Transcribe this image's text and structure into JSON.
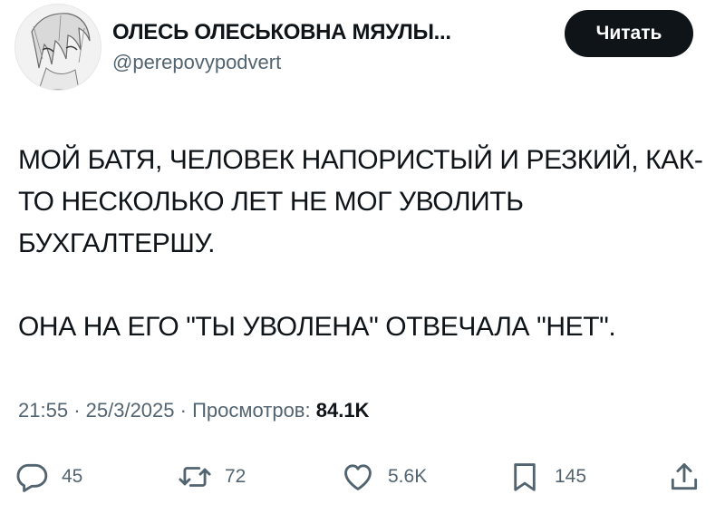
{
  "author": {
    "display_name": "ОЛЕСЬ ОЛЕСЬКОВНА МЯУЛЫ...",
    "handle": "@perepovypodvert",
    "follow_label": "Читать"
  },
  "tweet": {
    "paragraphs": [
      "МОЙ БАТЯ, ЧЕЛОВЕК НАПОРИСТЫЙ И РЕЗКИЙ, КАК-ТО НЕСКОЛЬКО ЛЕТ НЕ МОГ УВОЛИТЬ БУХГАЛТЕРШУ.",
      "ОНА НА ЕГО \"ТЫ УВОЛЕНА\" ОТВЕЧАЛА \"НЕТ\"."
    ],
    "time": "21:55",
    "separator": "·",
    "date": "25/3/2025",
    "views_label": "Просмотров:",
    "views_count": "84.1K"
  },
  "actions": {
    "replies": "45",
    "retweets": "72",
    "likes": "5.6K",
    "bookmarks": "145"
  },
  "icons": {
    "reply": "reply-bubble-icon",
    "retweet": "retweet-arrows-icon",
    "like": "heart-icon",
    "bookmark": "bookmark-icon",
    "share": "share-upload-icon"
  },
  "colors": {
    "text": "#0f1419",
    "secondary": "#536471",
    "button_bg": "#0f1419",
    "button_text": "#ffffff",
    "background": "#ffffff"
  }
}
